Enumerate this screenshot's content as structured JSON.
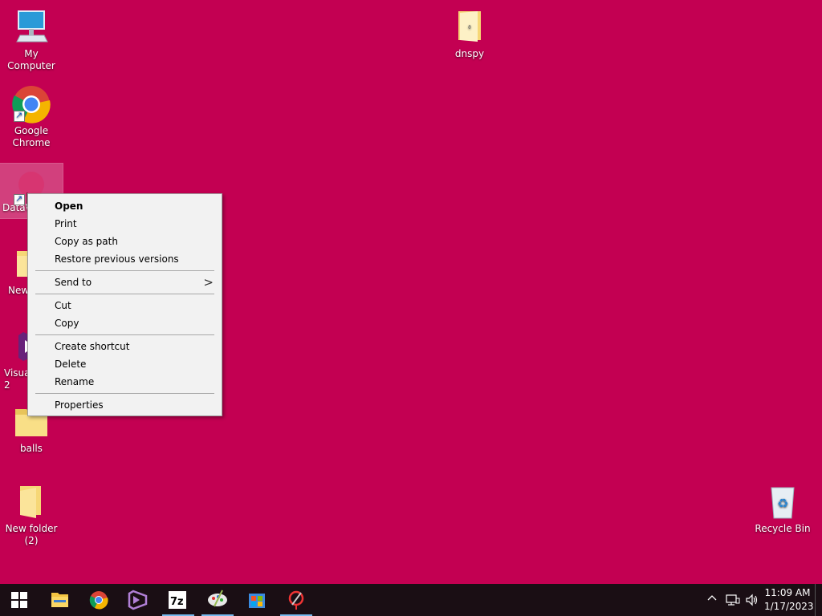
{
  "desktop": {
    "icons": [
      {
        "label": "My Computer"
      },
      {
        "label": "Google Chrome"
      },
      {
        "label": "DataW"
      },
      {
        "label": "New"
      },
      {
        "label": "Visua 2"
      },
      {
        "label": "balls"
      },
      {
        "label": "New folder (2)"
      },
      {
        "label": "dnspy"
      },
      {
        "label": "Recycle Bin"
      }
    ]
  },
  "context_menu": {
    "items": {
      "open": "Open",
      "print": "Print",
      "copy_as_path": "Copy as path",
      "restore": "Restore previous versions",
      "send_to": "Send to",
      "cut": "Cut",
      "copy": "Copy",
      "create_shortcut": "Create shortcut",
      "delete": "Delete",
      "rename": "Rename",
      "properties": "Properties"
    },
    "submenu_arrow": ">"
  },
  "taskbar": {
    "apps": [
      "start-icon",
      "file-explorer-icon",
      "chrome-icon",
      "visual-studio-icon",
      "7zip-icon",
      "paint-icon",
      "store-icon",
      "tool-icon"
    ]
  },
  "tray": {
    "chevron": "^",
    "time": "11:09 AM",
    "date": "1/17/2023"
  },
  "colors": {
    "desktop_bg": "#c30052",
    "taskbar_bg": "#1a0e14",
    "menu_bg": "#f2f2f2"
  }
}
